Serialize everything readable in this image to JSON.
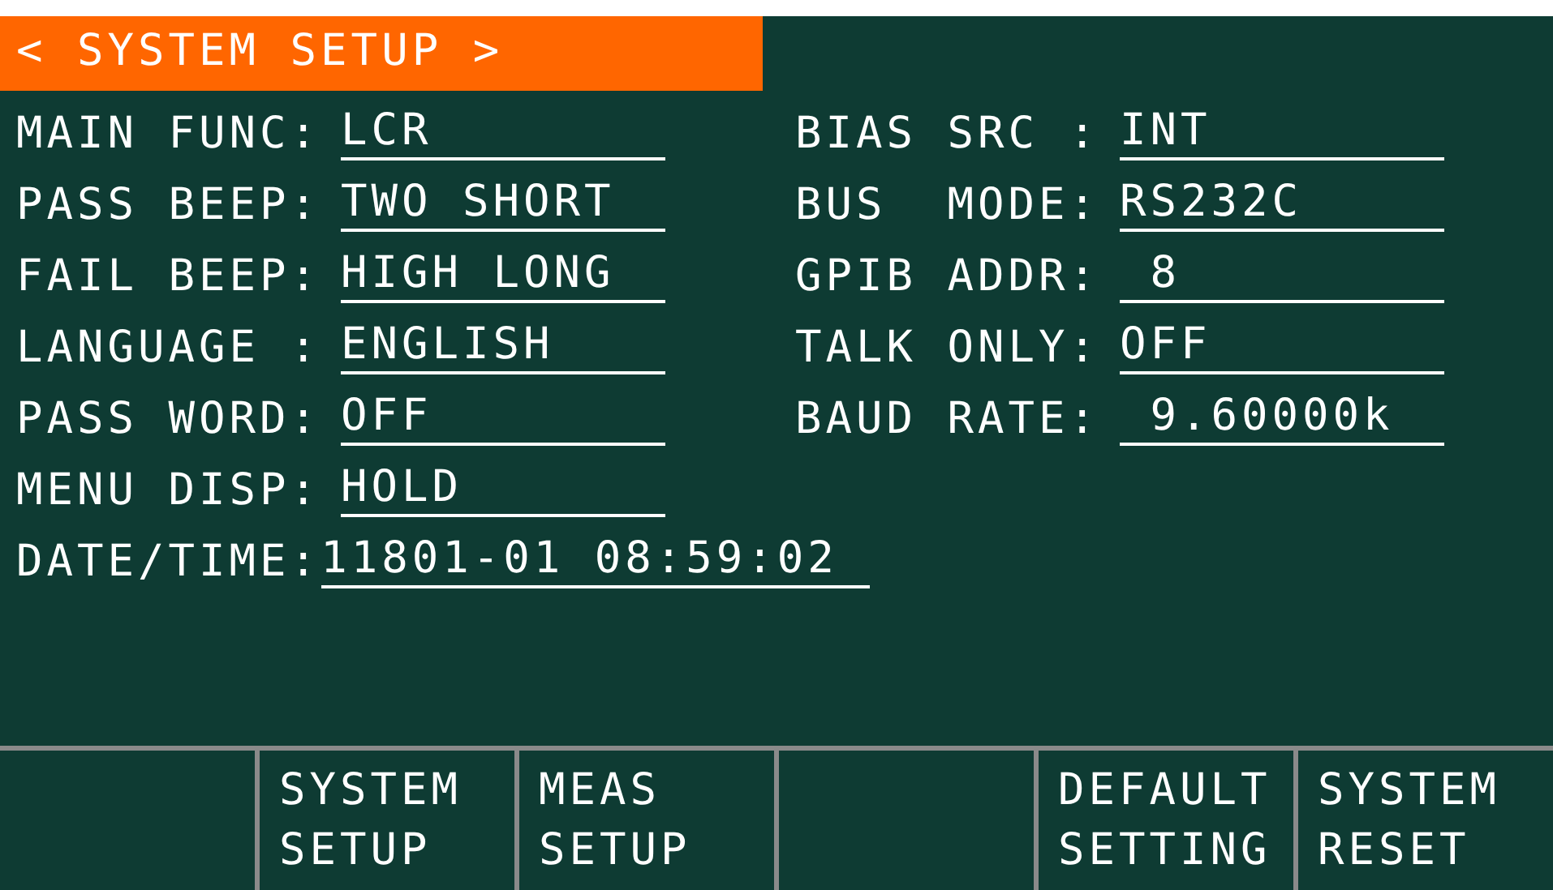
{
  "title": "< SYSTEM SETUP >",
  "left_fields": [
    {
      "label": "MAIN FUNC:",
      "value": "LCR"
    },
    {
      "label": "PASS BEEP:",
      "value": "TWO SHORT"
    },
    {
      "label": "FAIL BEEP:",
      "value": "HIGH LONG"
    },
    {
      "label": "LANGUAGE :",
      "value": "ENGLISH"
    },
    {
      "label": "PASS WORD:",
      "value": "OFF"
    },
    {
      "label": "MENU DISP:",
      "value": "HOLD"
    },
    {
      "label": "DATE/TIME:",
      "value": "11801-01 08:59:02"
    }
  ],
  "right_fields": [
    {
      "label": "BIAS SRC :",
      "value": "INT"
    },
    {
      "label": "BUS  MODE:",
      "value": "RS232C"
    },
    {
      "label": "GPIB ADDR:",
      "value": " 8"
    },
    {
      "label": "TALK ONLY:",
      "value": "OFF"
    },
    {
      "label": "BAUD RATE:",
      "value": " 9.60000k"
    }
  ],
  "softkeys": [
    {
      "kind": "blank"
    },
    {
      "kind": "labeled",
      "lines": [
        "SYSTEM",
        "SETUP"
      ]
    },
    {
      "kind": "labeled",
      "lines": [
        "MEAS",
        "SETUP"
      ]
    },
    {
      "kind": "blank"
    },
    {
      "kind": "labeled",
      "lines": [
        "DEFAULT",
        "SETTING"
      ]
    },
    {
      "kind": "labeled",
      "lines": [
        "SYSTEM",
        "RESET"
      ]
    }
  ]
}
